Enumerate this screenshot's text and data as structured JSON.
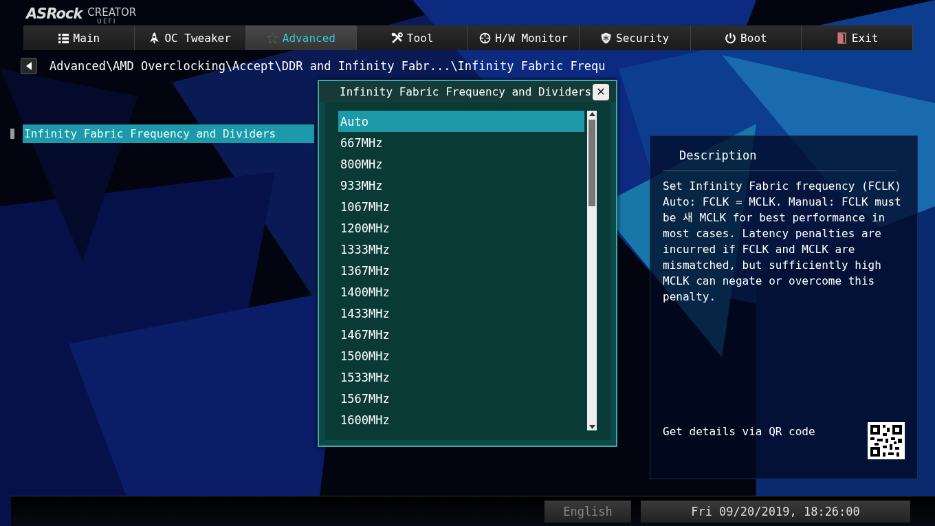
{
  "logo": {
    "brand": "ASRock",
    "product": "CREATOR",
    "edition": "UEFI"
  },
  "tabs": [
    {
      "label": "Main",
      "selected": false
    },
    {
      "label": "OC Tweaker",
      "selected": false
    },
    {
      "label": "Advanced",
      "selected": true
    },
    {
      "label": "Tool",
      "selected": false
    },
    {
      "label": "H/W Monitor",
      "selected": false
    },
    {
      "label": "Security",
      "selected": false
    },
    {
      "label": "Boot",
      "selected": false
    },
    {
      "label": "Exit",
      "selected": false
    }
  ],
  "breadcrumb": "Advanced\\AMD Overclocking\\Accept\\DDR and Infinity Fabr...\\Infinity Fabric Frequ",
  "settings": [
    {
      "label": "Infinity Fabric Frequency and Dividers",
      "selected": true
    }
  ],
  "dialog": {
    "title": "Infinity Fabric Frequency and Dividers",
    "close": "✕",
    "options": [
      {
        "label": "Auto",
        "selected": true
      },
      {
        "label": "667MHz",
        "selected": false
      },
      {
        "label": "800MHz",
        "selected": false
      },
      {
        "label": "933MHz",
        "selected": false
      },
      {
        "label": "1067MHz",
        "selected": false
      },
      {
        "label": "1200MHz",
        "selected": false
      },
      {
        "label": "1333MHz",
        "selected": false
      },
      {
        "label": "1367MHz",
        "selected": false
      },
      {
        "label": "1400MHz",
        "selected": false
      },
      {
        "label": "1433MHz",
        "selected": false
      },
      {
        "label": "1467MHz",
        "selected": false
      },
      {
        "label": "1500MHz",
        "selected": false
      },
      {
        "label": "1533MHz",
        "selected": false
      },
      {
        "label": "1567MHz",
        "selected": false
      },
      {
        "label": "1600MHz",
        "selected": false
      }
    ]
  },
  "description": {
    "title": "Description",
    "text": "Set Infinity Fabric frequency (FCLK) Auto: FCLK = MCLK. Manual: FCLK must be 새 MCLK for best performance in most cases. Latency penalties are incurred if FCLK and MCLK are mismatched, but sufficiently high MCLK can negate or overcome this penalty.",
    "qr_label": "Get details via QR code"
  },
  "status_bar": {
    "language": {
      "label": "English",
      "disabled": true
    },
    "datetime": "Fri 09/20/2019, 18:26:00"
  }
}
